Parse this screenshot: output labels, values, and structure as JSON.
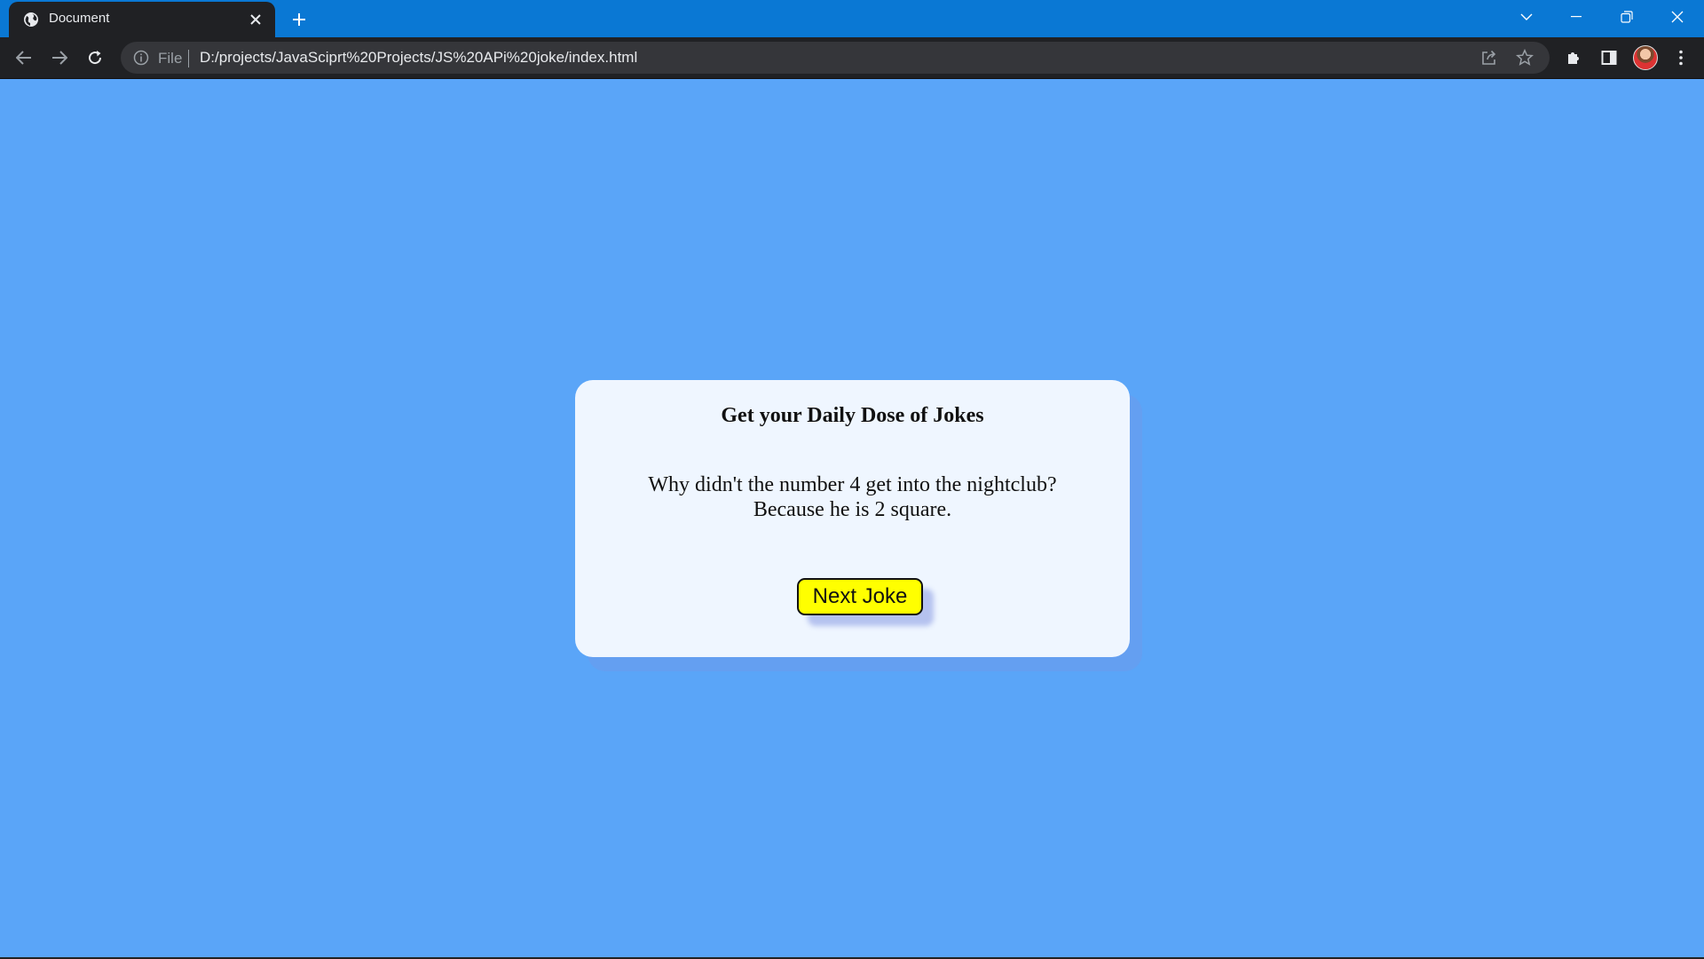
{
  "browser": {
    "tab_title": "Document",
    "address_scheme": "File",
    "address_url": "D:/projects/JavaSciprt%20Projects/JS%20APi%20joke/index.html"
  },
  "page": {
    "heading": "Get your Daily Dose of Jokes",
    "joke_setup": "Why didn't the number 4 get into the nightclub?",
    "joke_punchline": "Because he is 2 square.",
    "next_button_label": "Next Joke"
  },
  "colors": {
    "page_background": "#5aa5f8",
    "card_background": "#eff6ff",
    "button_background": "#ffff00",
    "titlebar": "#0a78d4"
  }
}
